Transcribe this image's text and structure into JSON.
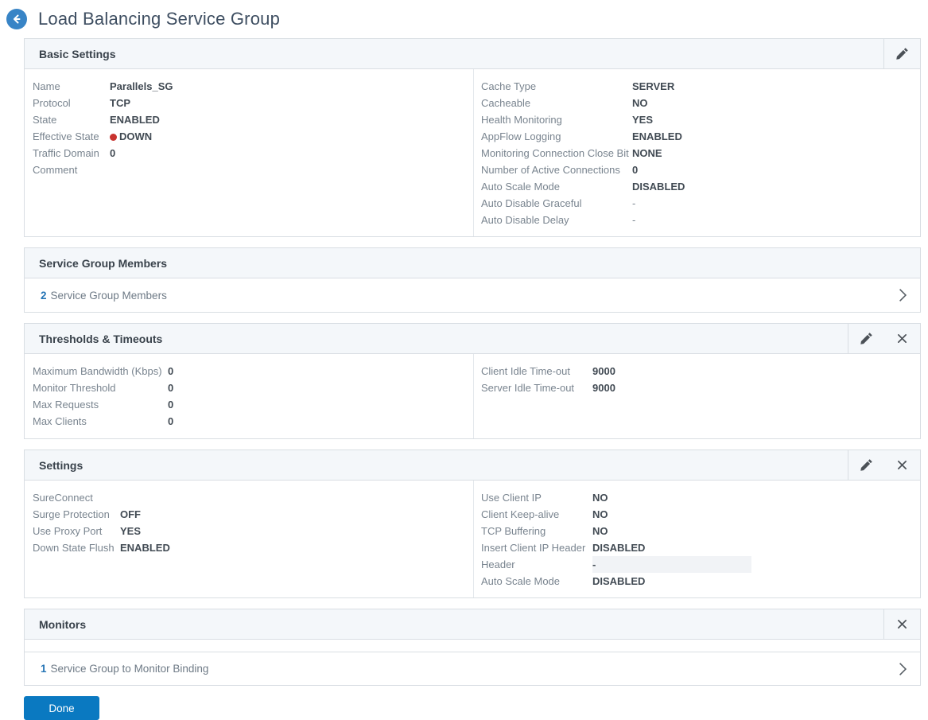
{
  "page": {
    "title": "Load Balancing Service Group",
    "back_icon": "arrow-left-icon"
  },
  "colors": {
    "accent_blue": "#2574b5",
    "back_circle": "#3884c6",
    "panel_header_bg": "#f4f7fa",
    "panel_border": "#d9dee3",
    "status_down_red": "#c8332f",
    "done_button_bg": "#0a79c1"
  },
  "panels": {
    "basic_settings": {
      "title": "Basic Settings",
      "actions": [
        "pencil-icon"
      ],
      "left": [
        {
          "label": "Name",
          "value": "Parallels_SG"
        },
        {
          "label": "Protocol",
          "value": "TCP"
        },
        {
          "label": "State",
          "value": "ENABLED"
        },
        {
          "label": "Effective State",
          "value": "DOWN",
          "dot": true
        },
        {
          "label": "Traffic Domain",
          "value": "0"
        },
        {
          "label": "Comment",
          "value": ""
        }
      ],
      "right": [
        {
          "label": "Cache Type",
          "value": "SERVER"
        },
        {
          "label": "Cacheable",
          "value": "NO"
        },
        {
          "label": "Health Monitoring",
          "value": "YES"
        },
        {
          "label": "AppFlow Logging",
          "value": "ENABLED"
        },
        {
          "label": "Monitoring Connection Close Bit",
          "value": "NONE"
        },
        {
          "label": "Number of Active Connections",
          "value": "0"
        },
        {
          "label": "Auto Scale Mode",
          "value": "DISABLED"
        },
        {
          "label": "Auto Disable Graceful",
          "value": "-",
          "muted": true
        },
        {
          "label": "Auto Disable Delay",
          "value": "-",
          "muted": true
        }
      ]
    },
    "service_group_members": {
      "title": "Service Group Members",
      "row": {
        "count": "2",
        "label": "Service Group Members"
      }
    },
    "thresholds": {
      "title": "Thresholds & Timeouts",
      "actions": [
        "pencil-icon",
        "close-icon"
      ],
      "left": [
        {
          "label": "Maximum Bandwidth (Kbps)",
          "value": "0"
        },
        {
          "label": "Monitor Threshold",
          "value": "0"
        },
        {
          "label": "Max Requests",
          "value": "0"
        },
        {
          "label": "Max Clients",
          "value": "0"
        }
      ],
      "right": [
        {
          "label": "Client Idle Time-out",
          "value": "9000"
        },
        {
          "label": "Server Idle Time-out",
          "value": "9000"
        }
      ]
    },
    "settings": {
      "title": "Settings",
      "actions": [
        "pencil-icon",
        "close-icon"
      ],
      "left": [
        {
          "label": "SureConnect",
          "value": ""
        },
        {
          "label": "Surge Protection",
          "value": "OFF"
        },
        {
          "label": "Use Proxy Port",
          "value": "YES"
        },
        {
          "label": "Down State Flush",
          "value": "ENABLED"
        }
      ],
      "right": [
        {
          "label": "Use Client IP",
          "value": "NO"
        },
        {
          "label": "Client Keep-alive",
          "value": "NO"
        },
        {
          "label": "TCP Buffering",
          "value": "NO"
        },
        {
          "label": "Insert Client IP Header",
          "value": "DISABLED"
        },
        {
          "label": "Header",
          "value": "-",
          "highlight": true
        },
        {
          "label": "Auto Scale Mode",
          "value": "DISABLED"
        }
      ]
    },
    "monitors": {
      "title": "Monitors",
      "actions": [
        "close-icon"
      ],
      "row": {
        "count": "1",
        "label": "Service Group to Monitor Binding"
      }
    }
  },
  "footer": {
    "done_label": "Done"
  }
}
